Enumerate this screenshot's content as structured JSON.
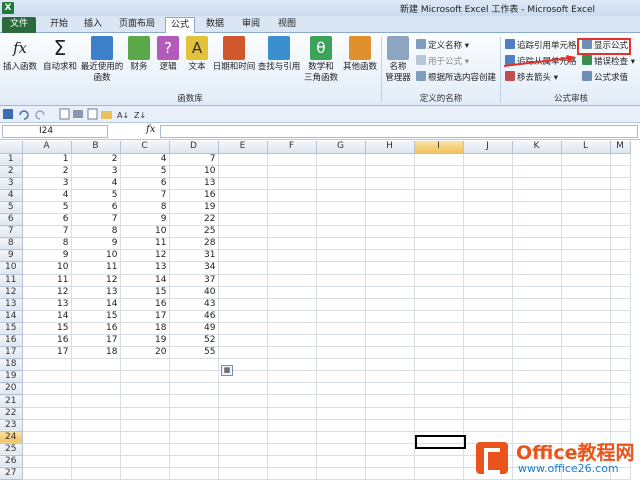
{
  "window": {
    "title": "新建 Microsoft Excel 工作表 - Microsoft Excel",
    "app_icon": "excel-icon"
  },
  "tabs": [
    "文件",
    "开始",
    "插入",
    "页面布局",
    "公式",
    "数据",
    "审阅",
    "视图"
  ],
  "active_tab": "公式",
  "ribbon": {
    "function_library": {
      "label": "函数库",
      "buttons": [
        "插入函数",
        "自动求和",
        "最近使用的\n函数",
        "财务",
        "逻辑",
        "文本",
        "日期和时间",
        "查找与引用",
        "数学和\n三角函数",
        "其他函数"
      ]
    },
    "defined_names": {
      "label": "定义的名称",
      "manager": "名称\n管理器",
      "define_name": "定义名称",
      "use_in_formula": "用于公式",
      "create_from_selection": "根据所选内容创建"
    },
    "formula_auditing": {
      "label": "公式审核",
      "trace_precedents": "追踪引用单元格",
      "trace_dependents": "追踪从属单元格",
      "remove_arrows": "移去箭头",
      "show_formulas": "显示公式",
      "error_checking": "错误检查",
      "evaluate_formula": "公式求值"
    }
  },
  "formula_bar": {
    "name_box": "I24",
    "fx": "fx",
    "value": ""
  },
  "columns": [
    "A",
    "B",
    "C",
    "D",
    "E",
    "F",
    "G",
    "H",
    "I",
    "J",
    "K",
    "L",
    "M"
  ],
  "active_cell": {
    "col": "I",
    "row": 24
  },
  "rows": [
    [
      1,
      2,
      4,
      7
    ],
    [
      2,
      3,
      5,
      10
    ],
    [
      3,
      4,
      6,
      13
    ],
    [
      4,
      5,
      7,
      16
    ],
    [
      5,
      6,
      8,
      19
    ],
    [
      6,
      7,
      9,
      22
    ],
    [
      7,
      8,
      10,
      25
    ],
    [
      8,
      9,
      11,
      28
    ],
    [
      9,
      10,
      12,
      31
    ],
    [
      10,
      11,
      13,
      34
    ],
    [
      11,
      12,
      14,
      37
    ],
    [
      12,
      13,
      15,
      40
    ],
    [
      13,
      14,
      16,
      43
    ],
    [
      14,
      15,
      17,
      46
    ],
    [
      15,
      16,
      18,
      49
    ],
    [
      16,
      17,
      19,
      52
    ],
    [
      17,
      18,
      20,
      55
    ]
  ],
  "row_count": 27,
  "watermark": {
    "name": "Office教程网",
    "url": "www.office26.com"
  },
  "colors": {
    "file_tab": "#2a6b3b",
    "highlight": "#e4322b",
    "watermark": "#e9541c"
  }
}
